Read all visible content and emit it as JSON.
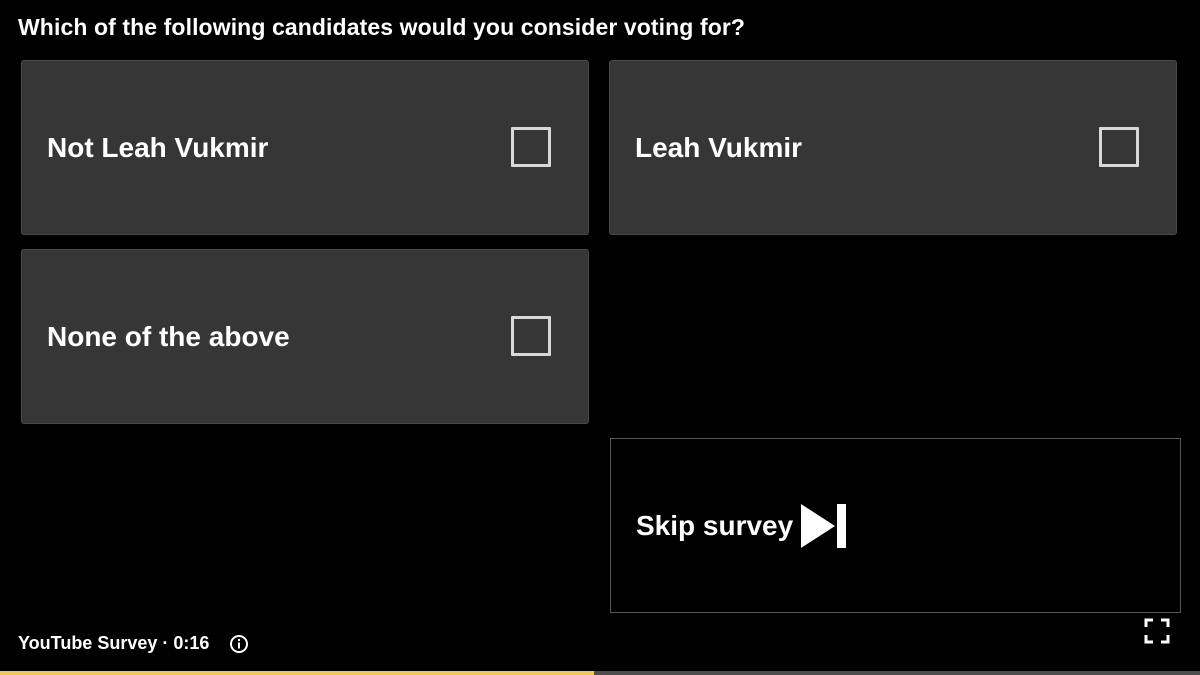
{
  "survey": {
    "question": "Which of the following candidates would you consider voting for?",
    "options": [
      {
        "label": "Not Leah Vukmir",
        "checked": false
      },
      {
        "label": "Leah Vukmir",
        "checked": false
      },
      {
        "label": "None of the above",
        "checked": false
      }
    ],
    "skip_label": "Skip survey",
    "skip_icon": "skip-next-icon"
  },
  "footer": {
    "source": "YouTube Survey",
    "separator": "·",
    "time": "0:16",
    "info_icon": "info-icon",
    "fullscreen_icon": "fullscreen-icon"
  },
  "progress": {
    "fraction": 0.495
  },
  "colors": {
    "background": "#000000",
    "option_bg": "#363636",
    "text": "#ffffff",
    "checkbox_border": "#d8d8d8",
    "progress_fill": "#f2c94c",
    "progress_track": "#4d4d4d"
  }
}
